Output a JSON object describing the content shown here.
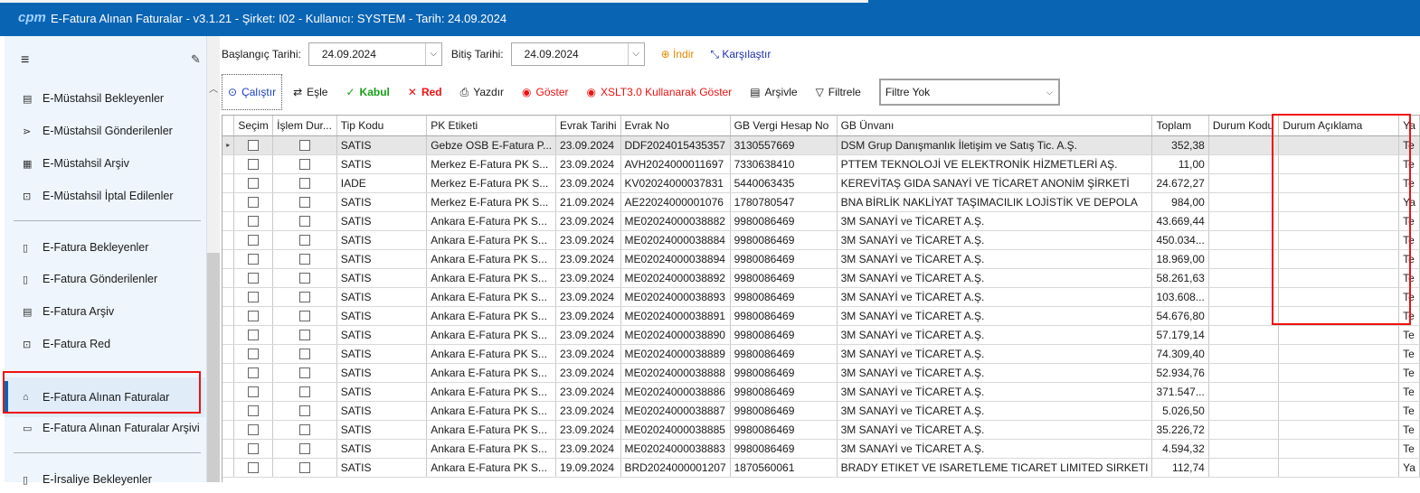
{
  "window": {
    "logo": "cpm",
    "title": "E-Fatura Alınan Faturalar - v3.1.21 - Şirket: I02 - Kullanıcı: SYSTEM - Tarih: 24.09.2024"
  },
  "sidebar": {
    "group1": [
      {
        "label": "E-Müstahsil Bekleyenler",
        "icon": "doc-icon"
      },
      {
        "label": "E-Müstahsil Gönderilenler",
        "icon": "send-icon"
      },
      {
        "label": "E-Müstahsil Arşiv",
        "icon": "archive-icon"
      },
      {
        "label": "E-Müstahsil İptal Edilenler",
        "icon": "cancel-doc-icon"
      }
    ],
    "group2": [
      {
        "label": "E-Fatura Bekleyenler",
        "icon": "doc-icon"
      },
      {
        "label": "E-Fatura Gönderilenler",
        "icon": "doc-icon"
      },
      {
        "label": "E-Fatura Arşiv",
        "icon": "archive-icon"
      },
      {
        "label": "E-Fatura Red",
        "icon": "reject-icon"
      },
      {
        "label": "E-Fatura Alınan Faturalar",
        "icon": "inbox-icon"
      },
      {
        "label": "E-Fatura Alınan Faturalar Arşivi",
        "icon": "folder-icon"
      }
    ],
    "group3": [
      {
        "label": "E-İrsaliye Bekleyenler",
        "icon": "doc-icon"
      }
    ]
  },
  "filters": {
    "start_label": "Başlangıç Tarihi:",
    "start_value": "24.09.2024",
    "end_label": "Bitiş Tarihi:",
    "end_value": "24.09.2024",
    "download": "İndir",
    "compare": "Karşılaştır"
  },
  "toolbar": {
    "run": "Çalıştır",
    "match": "Eşle",
    "accept": "Kabul",
    "reject": "Red",
    "print": "Yazdır",
    "show": "Göster",
    "xslt_show": "XSLT3.0 Kullanarak Göster",
    "archive": "Arşivle",
    "filter": "Filtrele",
    "filter_select": "Filtre Yok"
  },
  "grid": {
    "columns": [
      "Seçim",
      "İşlem Dur...",
      "Tip Kodu",
      "PK Etiketi",
      "Evrak Tarihi",
      "Evrak No",
      "GB Vergi Hesap No",
      "GB Ünvanı",
      "Toplam",
      "Durum Kodu",
      "Durum Açıklama",
      "Ya"
    ],
    "rows": [
      [
        "SATIS",
        "Gebze OSB E-Fatura P...",
        "23.09.2024",
        "DDF2024015435357",
        "3130557669",
        "DSM Grup Danışmanlık İletişim ve Satış Tic. A.Ş.",
        "352,38",
        "Te"
      ],
      [
        "SATIS",
        "Merkez E-Fatura PK S...",
        "23.09.2024",
        "AVH2024000011697",
        "7330638410",
        "PTTEM TEKNOLOJİ VE ELEKTRONİK HİZMETLERİ AŞ.",
        "11,00",
        "Te"
      ],
      [
        "IADE",
        "Merkez E-Fatura PK S...",
        "23.09.2024",
        "KV02024000037831",
        "5440063435",
        "KEREVİTAŞ GIDA SANAYİ VE TİCARET ANONİM ŞİRKETİ",
        "24.672,27",
        "Te"
      ],
      [
        "SATIS",
        "Merkez E-Fatura PK S...",
        "21.09.2024",
        "AE22024000001076",
        "1780780547",
        "BNA BİRLİK NAKLİYAT TAŞIMACILIK LOJİSTİK VE DEPOLA",
        "984,00",
        "Ya"
      ],
      [
        "SATIS",
        "Ankara E-Fatura PK S...",
        "23.09.2024",
        "ME02024000038882",
        "9980086469",
        "3M SANAYİ ve TİCARET A.Ş.",
        "43.669,44",
        "Te"
      ],
      [
        "SATIS",
        "Ankara E-Fatura PK S...",
        "23.09.2024",
        "ME02024000038884",
        "9980086469",
        "3M SANAYİ ve TİCARET A.Ş.",
        "450.034...",
        "Te"
      ],
      [
        "SATIS",
        "Ankara E-Fatura PK S...",
        "23.09.2024",
        "ME02024000038894",
        "9980086469",
        "3M SANAYİ ve TİCARET A.Ş.",
        "18.969,00",
        "Te"
      ],
      [
        "SATIS",
        "Ankara E-Fatura PK S...",
        "23.09.2024",
        "ME02024000038892",
        "9980086469",
        "3M SANAYİ ve TİCARET A.Ş.",
        "58.261,63",
        "Te"
      ],
      [
        "SATIS",
        "Ankara E-Fatura PK S...",
        "23.09.2024",
        "ME02024000038893",
        "9980086469",
        "3M SANAYİ ve TİCARET A.Ş.",
        "103.608...",
        "Te"
      ],
      [
        "SATIS",
        "Ankara E-Fatura PK S...",
        "23.09.2024",
        "ME02024000038891",
        "9980086469",
        "3M SANAYİ ve TİCARET A.Ş.",
        "54.676,80",
        "Te"
      ],
      [
        "SATIS",
        "Ankara E-Fatura PK S...",
        "23.09.2024",
        "ME02024000038890",
        "9980086469",
        "3M SANAYİ ve TİCARET A.Ş.",
        "57.179,14",
        "Te"
      ],
      [
        "SATIS",
        "Ankara E-Fatura PK S...",
        "23.09.2024",
        "ME02024000038889",
        "9980086469",
        "3M SANAYİ ve TİCARET A.Ş.",
        "74.309,40",
        "Te"
      ],
      [
        "SATIS",
        "Ankara E-Fatura PK S...",
        "23.09.2024",
        "ME02024000038888",
        "9980086469",
        "3M SANAYİ ve TİCARET A.Ş.",
        "52.934,76",
        "Te"
      ],
      [
        "SATIS",
        "Ankara E-Fatura PK S...",
        "23.09.2024",
        "ME02024000038886",
        "9980086469",
        "3M SANAYİ ve TİCARET A.Ş.",
        "371.547...",
        "Te"
      ],
      [
        "SATIS",
        "Ankara E-Fatura PK S...",
        "23.09.2024",
        "ME02024000038887",
        "9980086469",
        "3M SANAYİ ve TİCARET A.Ş.",
        "5.026,50",
        "Te"
      ],
      [
        "SATIS",
        "Ankara E-Fatura PK S...",
        "23.09.2024",
        "ME02024000038885",
        "9980086469",
        "3M SANAYİ ve TİCARET A.Ş.",
        "35.226,72",
        "Te"
      ],
      [
        "SATIS",
        "Ankara E-Fatura PK S...",
        "23.09.2024",
        "ME02024000038883",
        "9980086469",
        "3M SANAYİ ve TİCARET A.Ş.",
        "4.594,32",
        "Te"
      ],
      [
        "SATIS",
        "Ankara E-Fatura PK S...",
        "19.09.2024",
        "BRD2024000001207",
        "1870560061",
        "BRADY ETIKET VE ISARETLEME TICARET LIMITED SIRKETI",
        "112,74",
        "Ya"
      ]
    ]
  },
  "colors": {
    "titlebar": "#0a64b4",
    "highlight_box": "#ee1111",
    "accept": "#18a018",
    "reject": "#ee1111"
  }
}
